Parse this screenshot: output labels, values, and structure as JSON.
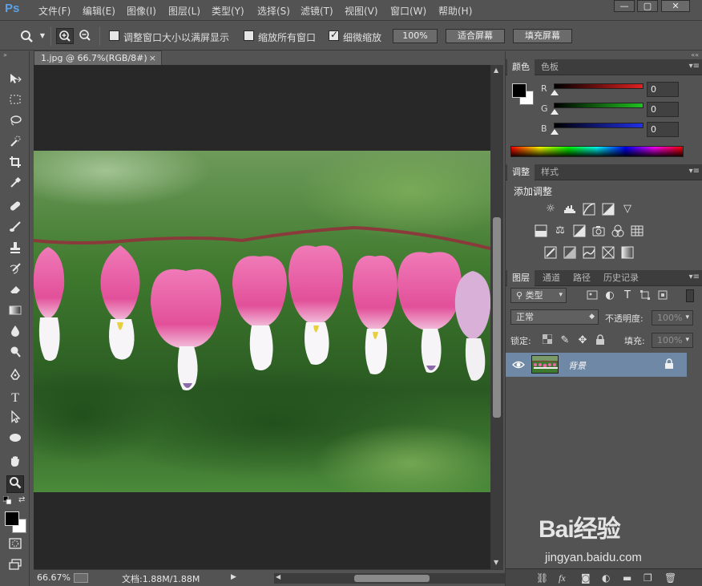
{
  "app": {
    "logo": "Ps"
  },
  "menu": [
    "文件(F)",
    "编辑(E)",
    "图像(I)",
    "图层(L)",
    "类型(Y)",
    "选择(S)",
    "滤镜(T)",
    "视图(V)",
    "窗口(W)",
    "帮助(H)"
  ],
  "window_controls": {
    "minimize": "—",
    "restore": "▢",
    "close": "✕"
  },
  "options": {
    "resize_windows_label": "调整窗口大小以满屏显示",
    "resize_windows_checked": false,
    "zoom_all_label": "缩放所有窗口",
    "zoom_all_checked": false,
    "scrubby_zoom_label": "细微缩放",
    "scrubby_zoom_checked": true,
    "btn_100": "100%",
    "btn_fit": "适合屏幕",
    "btn_fill": "填充屏幕"
  },
  "document": {
    "tab_title": "1.jpg @ 66.7%(RGB/8#)",
    "tab_close": "×",
    "zoom_status": "66.67%",
    "doc_status": "文档:1.88M/1.88M"
  },
  "color_panel": {
    "tabs": [
      "颜色",
      "色板"
    ],
    "channels": [
      {
        "label": "R",
        "value": "0",
        "color": "#d42020"
      },
      {
        "label": "G",
        "value": "0",
        "color": "#20b020"
      },
      {
        "label": "B",
        "value": "0",
        "color": "#2020d8"
      }
    ],
    "foreground": "#000000",
    "background": "#ffffff"
  },
  "adjustments_panel": {
    "tabs": [
      "调整",
      "样式"
    ],
    "title": "添加调整"
  },
  "layers_panel": {
    "tabs": [
      "图层",
      "通道",
      "路径",
      "历史记录"
    ],
    "filter_type": "类型",
    "blend_mode": "正常",
    "opacity_label": "不透明度:",
    "opacity_value": "100%",
    "lock_label": "锁定:",
    "fill_label": "填充:",
    "fill_value": "100%",
    "layers": [
      {
        "name": "背景",
        "visible": true,
        "locked": true
      }
    ]
  },
  "watermark": {
    "logo": "Bai经验",
    "url": "jingyan.baidu.com"
  }
}
